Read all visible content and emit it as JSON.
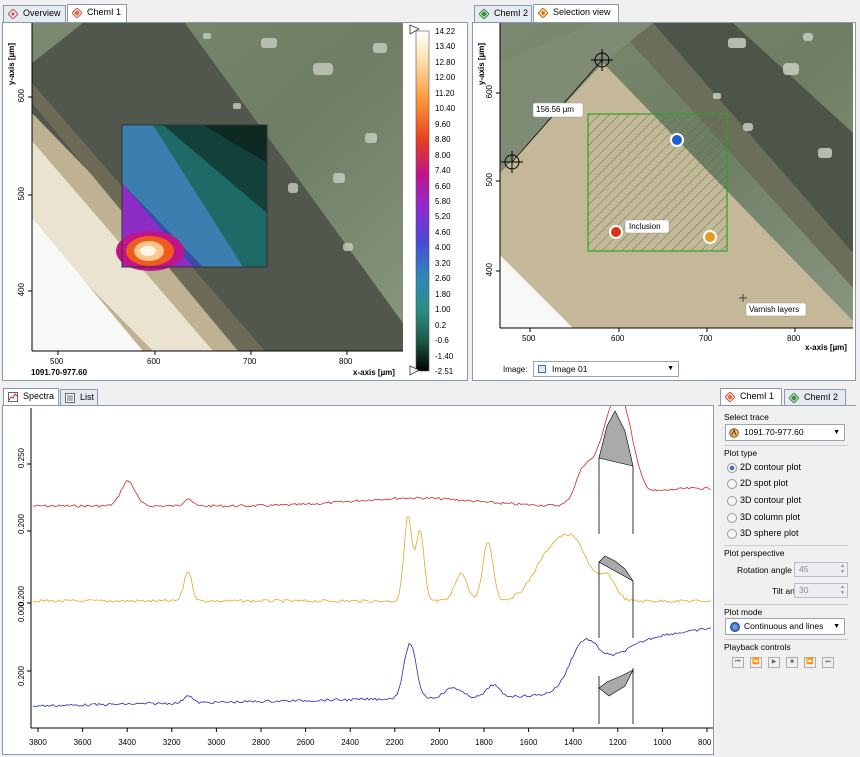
{
  "left_panel": {
    "tabs": [
      {
        "label": "Overview"
      },
      {
        "label": "ChemI 1"
      }
    ],
    "y_axis_label": "y-axis [µm]",
    "x_axis_label": "x-axis [µm]",
    "y_ticks": [
      "600",
      "500",
      "400"
    ],
    "x_ticks": [
      "500",
      "600",
      "700",
      "800"
    ],
    "coordinate_readout": "1091.70-977.60",
    "colorbar_ticks": [
      "14.22",
      "13.40",
      "12.80",
      "12.00",
      "11.20",
      "10.40",
      "9.60",
      "8.80",
      "8.00",
      "7.40",
      "6.60",
      "5.80",
      "5.20",
      "4.60",
      "4.00",
      "3.20",
      "2.60",
      "1.80",
      "1.00",
      "0.2",
      "-0.6",
      "-1.40",
      "-2.51"
    ]
  },
  "right_panel": {
    "tabs": [
      {
        "label": "ChemI 2"
      },
      {
        "label": "Selection view"
      }
    ],
    "y_axis_label": "y-axis [µm]",
    "x_axis_label": "x-axis [µm]",
    "y_ticks": [
      "600",
      "500",
      "400"
    ],
    "x_ticks": [
      "500",
      "600",
      "700",
      "800"
    ],
    "distance_label": "156.56 µm",
    "inclusion_label": "Inclusion",
    "varnish_label": "Varnish layers",
    "image_label": "Image:",
    "image_select": "Image 01",
    "markers": [
      {
        "name": "blue-marker",
        "color": "#1f5fd6"
      },
      {
        "name": "red-marker",
        "color": "#d83218"
      },
      {
        "name": "orange-marker",
        "color": "#e49a1c"
      }
    ]
  },
  "spectra_panel": {
    "tabs": [
      {
        "label": "Spectra"
      },
      {
        "label": "List"
      }
    ],
    "y_ticks": [
      "0.250",
      "0.200",
      "0.200",
      "0.000",
      "0.200"
    ],
    "x_ticks": [
      "3800",
      "3600",
      "3400",
      "3200",
      "3000",
      "2800",
      "2600",
      "2400",
      "2200",
      "2000",
      "1800",
      "1600",
      "1400",
      "1200",
      "1000",
      "800"
    ],
    "series_colors": [
      "#cc2b2b",
      "#e0a92a",
      "#2a2ab0"
    ]
  },
  "sidebar": {
    "tabs": [
      {
        "label": "ChemI 1"
      },
      {
        "label": "ChemI 2"
      }
    ],
    "select_trace_label": "Select trace",
    "trace_value": "1091.70-977.60",
    "plot_type_label": "Plot type",
    "plot_types": [
      {
        "label": "2D contour plot",
        "selected": true
      },
      {
        "label": "2D spot plot",
        "selected": false
      },
      {
        "label": "3D contour plot",
        "selected": false
      },
      {
        "label": "3D column plot",
        "selected": false
      },
      {
        "label": "3D sphere plot",
        "selected": false
      }
    ],
    "plot_perspective_label": "Plot perspective",
    "rotation_label": "Rotation angle",
    "rotation_value": "45",
    "tilt_label": "Tilt angle",
    "tilt_value": "30",
    "plot_mode_label": "Plot mode",
    "plot_mode_value": "Continuous and lines",
    "playback_label": "Playback controls",
    "playback_buttons": [
      {
        "name": "first-frame-button",
        "glyph": "⏮"
      },
      {
        "name": "rewind-button",
        "glyph": "⏪"
      },
      {
        "name": "play-button",
        "glyph": "▶"
      },
      {
        "name": "stop-button",
        "glyph": "■"
      },
      {
        "name": "fast-forward-button",
        "glyph": "⏩"
      },
      {
        "name": "last-frame-button",
        "glyph": "⏭"
      }
    ]
  }
}
